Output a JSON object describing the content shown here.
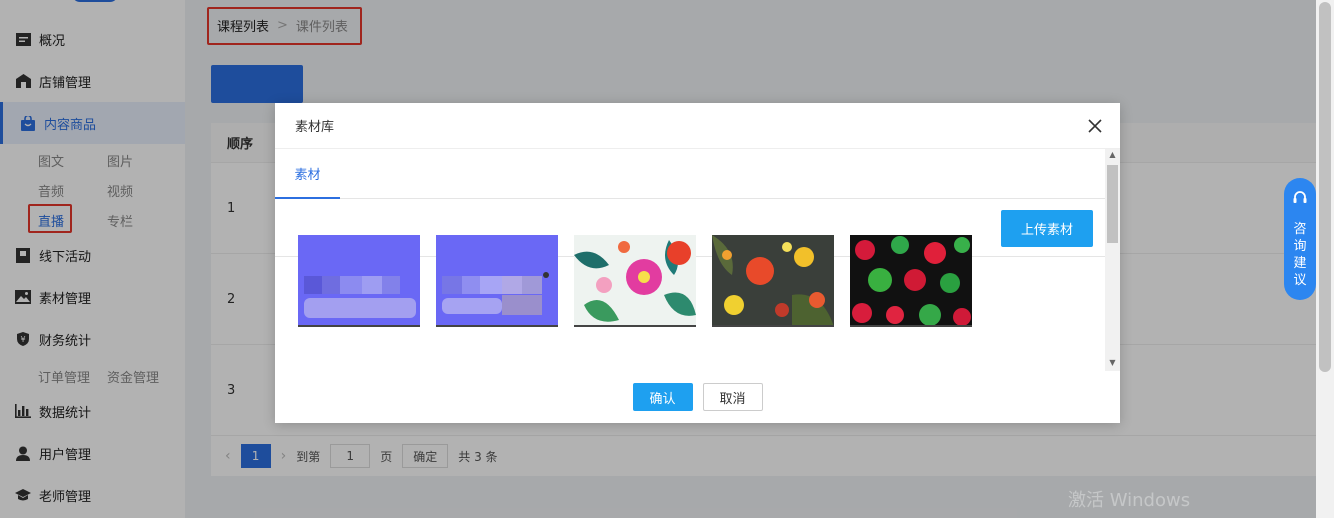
{
  "sidebar": {
    "items": [
      {
        "label": "概况",
        "icon": "document-icon"
      },
      {
        "label": "店铺管理",
        "icon": "store-icon"
      },
      {
        "label": "内容商品",
        "icon": "bag-icon"
      },
      {
        "label": "线下活动",
        "icon": "flag-icon"
      },
      {
        "label": "素材管理",
        "icon": "image-icon"
      },
      {
        "label": "财务统计",
        "icon": "yen-icon"
      },
      {
        "label": "数据统计",
        "icon": "bar-chart-icon"
      },
      {
        "label": "用户管理",
        "icon": "user-icon"
      },
      {
        "label": "老师管理",
        "icon": "graduation-cap-icon"
      }
    ],
    "content_sub": [
      "图文",
      "图片",
      "音频",
      "视频",
      "直播",
      "专栏"
    ],
    "finance_sub": [
      "订单管理",
      "资金管理"
    ]
  },
  "breadcrumb": {
    "first": "课程列表",
    "separator": ">",
    "second": "课件列表"
  },
  "table": {
    "header": "顺序",
    "rows": [
      "1",
      "2",
      "3"
    ]
  },
  "pager": {
    "current": "1",
    "goto_label": "到第",
    "page_input": "1",
    "page_label": "页",
    "confirm": "确定",
    "total": "共 3 条"
  },
  "help": {
    "label_chars": [
      "咨",
      "询",
      "建",
      "议"
    ]
  },
  "watermark": "激活 Windows",
  "modal": {
    "title": "素材库",
    "tab": "素材",
    "upload": "上传素材",
    "ok": "确认",
    "cancel": "取消"
  },
  "colors": {
    "accent": "#2c6fe0",
    "button": "#1ea0f0",
    "highlight": "#e5352a"
  }
}
